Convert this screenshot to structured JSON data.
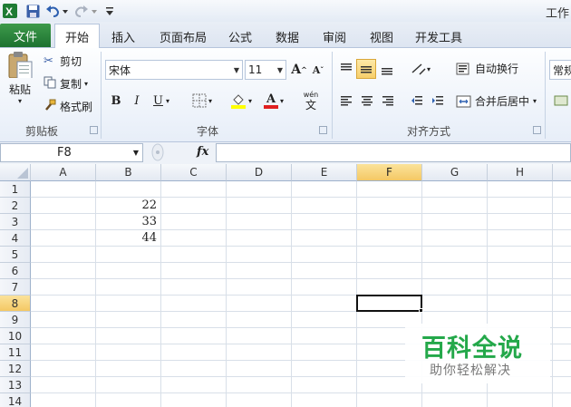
{
  "title_bar": {
    "title": "工作"
  },
  "tabs": {
    "file": "文件",
    "home": "开始",
    "insert": "插入",
    "page_layout": "页面布局",
    "formulas": "公式",
    "data": "数据",
    "review": "审阅",
    "view": "视图",
    "developer": "开发工具"
  },
  "clipboard": {
    "paste": "粘贴",
    "cut": "剪切",
    "copy": "复制",
    "format_painter": "格式刷",
    "group_label": "剪贴板"
  },
  "font": {
    "font_name": "宋体",
    "font_size": "11",
    "bold": "B",
    "italic": "I",
    "underline": "U",
    "grow": "A",
    "shrink": "A",
    "font_color_letter": "A",
    "phonetic": "文",
    "phonetic_top": "wén",
    "group_label": "字体"
  },
  "alignment": {
    "wrap_text": "自动换行",
    "merge_center": "合并后居中",
    "group_label": "对齐方式"
  },
  "number": {
    "format": "常规"
  },
  "formula_bar": {
    "name_box": "F8",
    "fx": "fx",
    "value": ""
  },
  "columns": [
    "A",
    "B",
    "C",
    "D",
    "E",
    "F",
    "G",
    "H"
  ],
  "rows": [
    "1",
    "2",
    "3",
    "4",
    "5",
    "6",
    "7",
    "8",
    "9",
    "10",
    "11",
    "12",
    "13",
    "14"
  ],
  "cells": [
    {
      "ref": "B2",
      "value": "22"
    },
    {
      "ref": "B3",
      "value": "33"
    },
    {
      "ref": "B4",
      "value": "44"
    }
  ],
  "selection": {
    "active_cell": "F8"
  },
  "watermark": {
    "title": "百科全说",
    "subtitle": "助你轻松解决"
  },
  "colors": {
    "file_tab": "#1d7230",
    "selected_header": "#f4c864",
    "watermark_green": "#24a84a"
  }
}
